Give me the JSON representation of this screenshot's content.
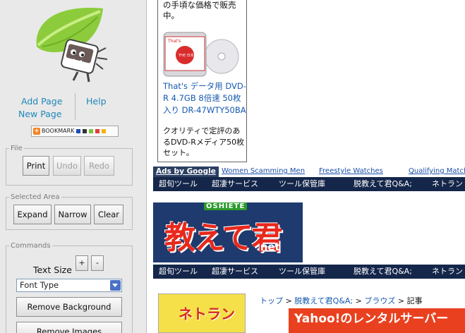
{
  "sidebar": {
    "add_page": "Add Page",
    "help": "Help",
    "new_page": "New Page",
    "bookmark_label": "BOOKMARK",
    "file_group": {
      "legend": "File",
      "print": "Print",
      "undo": "Undo",
      "redo": "Redo"
    },
    "selected_group": {
      "legend": "Selected Area",
      "expand": "Expand",
      "narrow": "Narrow",
      "clear": "Clear"
    },
    "commands_group": {
      "legend": "Commands",
      "text_size_label": "Text Size",
      "plus": "+",
      "minus": "-",
      "font_type_value": "Font Type",
      "remove_background": "Remove Background",
      "remove_images": "Remove Images"
    }
  },
  "page": {
    "ad_top_text": "の手頃な価格で販売中。",
    "disc_brand": "That's",
    "disc_badge": "THE 日本君",
    "product_title": "That's データ用 DVD-R 4.7GB 8倍速 50枚入り DR-47WTY50BA",
    "product_desc": "クオリティで定評のあるDVD-Rメディア50枚セット。",
    "ads_by": "Ads by Google",
    "ad_links": [
      "Women Scamming Men",
      "Freestyle Watches",
      "Qualifying Match"
    ],
    "nav_items": [
      "超旬ツール",
      "超凄サービス",
      "ツール保管庫",
      "脱教えて君Q&A;",
      "ネトラン"
    ],
    "logo_text": "教えて君",
    "logo_oshiete": "OSHIETE",
    "logo_net": ".net",
    "breadcrumb": {
      "top": "トップ",
      "sep1": " > ",
      "qa": "脱教えて君Q&A;",
      "sep2": " > ",
      "browser": "ブラウズ",
      "sep3": " > ",
      "article": "記事"
    },
    "book_title": "ネトラン",
    "yahoo_banner": "Yahoo!のレンタルサーバー"
  },
  "colors": {
    "sidebar_bg": "#e9e9e9",
    "link": "#1f87b8",
    "nav_bg": "#14264a",
    "banner_bg": "#1e3a6e",
    "logo_red": "#e8281c",
    "page_link": "#1558b0",
    "yahoo_red": "#e9411f"
  },
  "icons": [
    "leaf-mascot-icon",
    "bookmark-plus-icon",
    "dropdown-arrow-icon",
    "dvd-disc-icon"
  ]
}
